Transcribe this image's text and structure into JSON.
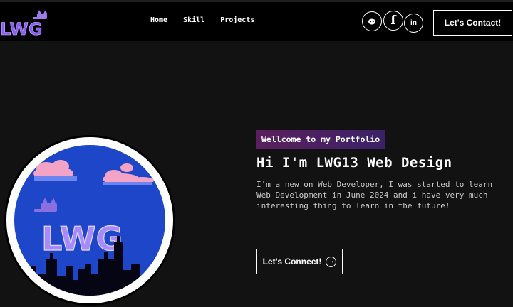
{
  "nav": {
    "logo_text": "LWG",
    "links": [
      "Home",
      "Skill",
      "Projects"
    ],
    "socials": [
      {
        "icon": "discord-icon",
        "glyph": "●"
      },
      {
        "icon": "facebook-icon",
        "glyph": "f"
      },
      {
        "icon": "linkedin-icon",
        "glyph": "in"
      }
    ],
    "contact_label": "Let's Contact!"
  },
  "hero": {
    "tagline": "Wellcome to my Portfolio",
    "headline": "Hi I'm LWG13 Web Design",
    "intro": "I'm a new on Web Developer, I was started to learn Web Development in June 2024 and i have very much interesting thing to learn in the future!",
    "connect_label": "Let's Connect!",
    "avatar_text": "LWG"
  },
  "colors": {
    "background": "#121212",
    "navbar": "#000000",
    "tagline_start": "#5b1f5e",
    "tagline_end": "#3a2266",
    "logo_purple": "#8b5cf6",
    "avatar_sky": "#1d46c8"
  }
}
